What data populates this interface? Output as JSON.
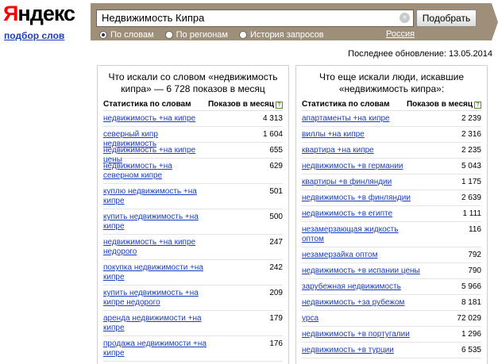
{
  "header": {
    "logo_first": "Я",
    "logo_rest": "ндекс",
    "sublogo": "подбор слов",
    "search_value": "Недвижимость Кипра",
    "submit_label": "Подобрать",
    "radios": [
      {
        "label": "По словам",
        "checked": true
      },
      {
        "label": "По регионам",
        "checked": false
      },
      {
        "label": "История запросов",
        "checked": false
      }
    ],
    "region": "Россия"
  },
  "updated": "Последнее обновление: 13.05.2014",
  "left_panel": {
    "title": "Что искали со словом «недвижимость кипра» — 6 728 показов в месяц",
    "col_phrase": "Статистика по словам",
    "col_count": "Показов в месяц",
    "rows": [
      {
        "phrase": "недвижимость +на кипре",
        "count": "4 313"
      },
      {
        "phrase": "северный кипр недвижимость",
        "count": "1 604"
      },
      {
        "phrase": "недвижимость +на кипре цены",
        "count": "655"
      },
      {
        "phrase": "недвижимость +на северном кипре",
        "count": "629"
      },
      {
        "phrase": "куплю недвижимость +на кипре",
        "count": "501"
      },
      {
        "phrase": "купить недвижимость +на кипре",
        "count": "500"
      },
      {
        "phrase": "недвижимость +на кипре недорого",
        "count": "247"
      },
      {
        "phrase": "покупка недвижимости +на кипре",
        "count": "242"
      },
      {
        "phrase": "купить недвижимость +на кипре недорого",
        "count": "209"
      },
      {
        "phrase": "аренда недвижимости +на кипре",
        "count": "179"
      },
      {
        "phrase": "продажа недвижимости +на кипре",
        "count": "176"
      }
    ]
  },
  "right_panel": {
    "title": "Что еще искали люди, искавшие «недвижимость кипра»:",
    "col_phrase": "Статистика по словам",
    "col_count": "Показов в месяц",
    "rows": [
      {
        "phrase": "апартаменты +на кипре",
        "count": "2 239"
      },
      {
        "phrase": "виллы +на кипре",
        "count": "2 316"
      },
      {
        "phrase": "квартира +на кипре",
        "count": "2 235"
      },
      {
        "phrase": "недвижимость +в германии",
        "count": "5 043"
      },
      {
        "phrase": "квартиры +в финляндии",
        "count": "1 175"
      },
      {
        "phrase": "недвижимость +в финляндии",
        "count": "2 639"
      },
      {
        "phrase": "недвижимость +в египте",
        "count": "1 111"
      },
      {
        "phrase": "незамерзающая жидкость оптом",
        "count": "116"
      },
      {
        "phrase": "незамерзайка оптом",
        "count": "792"
      },
      {
        "phrase": "недвижимость +в испании цены",
        "count": "790"
      },
      {
        "phrase": "зарубежная недвижимость",
        "count": "5 966"
      },
      {
        "phrase": "недвижимость +за рубежом",
        "count": "8 181"
      },
      {
        "phrase": "урса",
        "count": "72 029"
      },
      {
        "phrase": "недвижимость +в португалии",
        "count": "1 296"
      },
      {
        "phrase": "недвижимость +в турции",
        "count": "6 535"
      }
    ]
  }
}
